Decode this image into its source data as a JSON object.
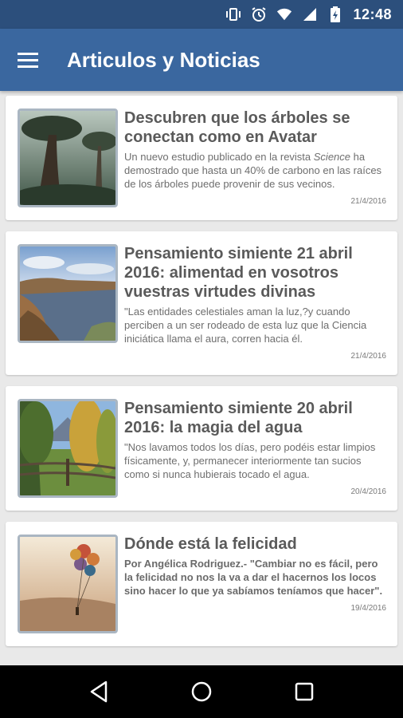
{
  "status_bar": {
    "time": "12:48",
    "icons": [
      "vibrate-icon",
      "alarm-icon",
      "wifi-icon",
      "signal-icon",
      "battery-charging-icon"
    ]
  },
  "app_bar": {
    "title": "Articulos y Noticias",
    "menu_icon": "hamburger-menu-icon"
  },
  "articles": [
    {
      "title": "Descubren que los árboles se conectan como en Avatar",
      "desc_pre": "Un nuevo estudio publicado en la revista ",
      "desc_em": "Science",
      "desc_post": " ha demostrado que hasta un 40% de carbono en las raíces de los árboles puede provenir de sus vecinos.",
      "date": "21/4/2016"
    },
    {
      "title": "Pensamiento simiente 21 abril 2016: alimentad en vosotros vuestras virtudes divinas",
      "desc": "\"Las entidades celestiales aman la luz,?y cuando perciben a un ser rodeado de esta luz que la Ciencia iniciática llama el aura, corren hacia él.",
      "date": "21/4/2016"
    },
    {
      "title": "Pensamiento simiente 20 abril 2016: la magia del agua",
      "desc": "\"Nos lavamos todos los días, pero podéis estar limpios físicamente, y, permanecer interiormente tan sucios como si nunca hubierais tocado el agua.",
      "date": "20/4/2016"
    },
    {
      "title": "Dónde está la felicidad",
      "desc": "Por Angélica Rodriguez.- \"Cambiar no es fácil, pero la felicidad no nos la va a dar el hacernos los locos sino hacer lo que ya sabíamos teníamos que hacer\".",
      "date": "19/4/2016"
    }
  ],
  "nav_bar": {
    "back_icon": "back-triangle-icon",
    "home_icon": "home-circle-icon",
    "recents_icon": "recents-square-icon"
  },
  "colors": {
    "status_bar": "#2c4f7c",
    "app_bar": "#3a679f",
    "background": "#e9e9e9",
    "title_text": "#5a5a5a"
  }
}
